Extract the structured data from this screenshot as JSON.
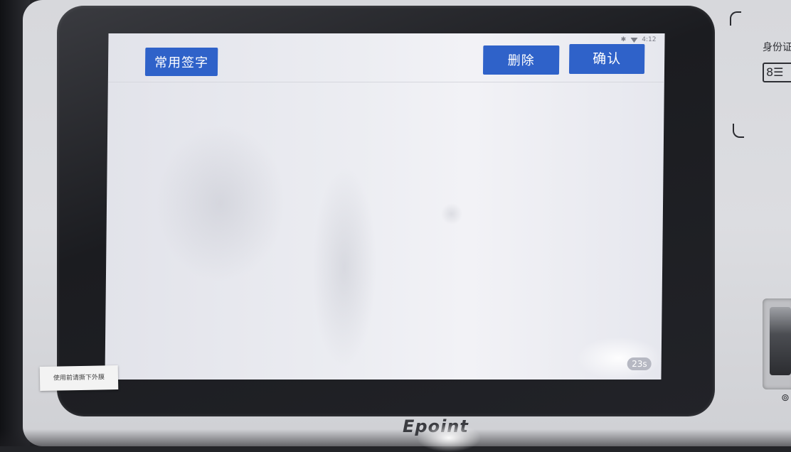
{
  "screen": {
    "status": {
      "bluetooth_icon": "bluetooth-icon",
      "wifi_icon": "wifi-icon",
      "time": "4:12"
    },
    "toolbar": {
      "common_signature_label": "常用签字",
      "delete_label": "删除",
      "confirm_label": "确认"
    },
    "countdown": "23s"
  },
  "device": {
    "sticker_text": "使用前请撕下外膜",
    "brand": "Epoint",
    "side_label": "身份证",
    "side_icons": [
      "id-card-icon",
      "fingerprint-icon"
    ]
  },
  "colors": {
    "button_blue": "#2f62c9",
    "screen_bg": "#eceef2",
    "bezel": "#1d1e22"
  }
}
